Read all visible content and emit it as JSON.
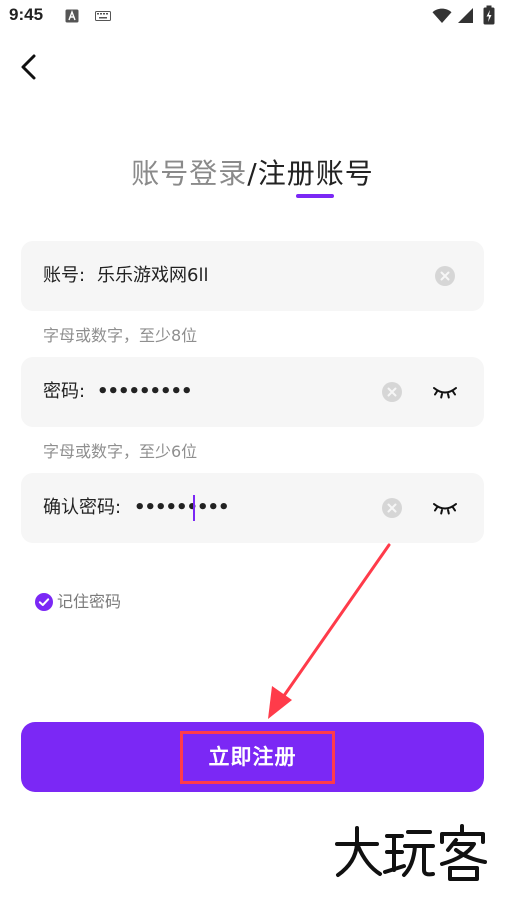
{
  "status_bar": {
    "time": "9:45",
    "icons": [
      "keyboard-a-icon",
      "keyboard-icon",
      "wifi-icon",
      "signal-icon",
      "battery-charging-icon"
    ]
  },
  "header": {
    "back_icon": "chevron-left-icon"
  },
  "title": {
    "login": "账号登录",
    "separator": "/",
    "register": "注册账号",
    "active": "register"
  },
  "form": {
    "account": {
      "label": "账号:",
      "value": "乐乐游戏网6ll",
      "hint": "字母或数字，至少8位"
    },
    "password": {
      "label": "密码:",
      "value": "•••••••••",
      "hint": "字母或数字，至少6位"
    },
    "confirm_password": {
      "label": "确认密码:",
      "value": "•••••••••"
    },
    "remember": {
      "label": "记住密码",
      "checked": true
    },
    "submit_label": "立即注册"
  },
  "colors": {
    "accent": "#7b28f5",
    "annotation": "#ff3b4a",
    "field_bg": "#f6f6f6",
    "hint": "#8f8f8f"
  },
  "watermark": {
    "text": "大玩客"
  }
}
